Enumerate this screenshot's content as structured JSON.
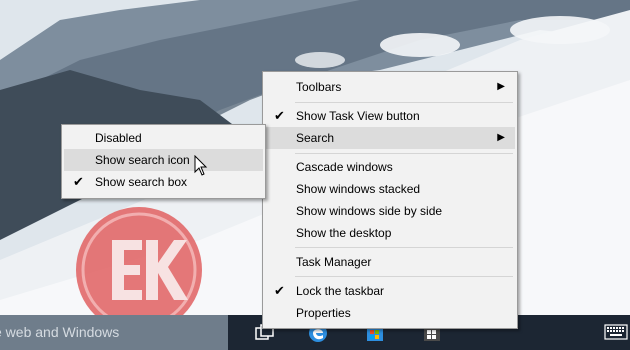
{
  "taskbar": {
    "search_text": "e web and Windows"
  },
  "main_menu": {
    "items": [
      {
        "label": "Toolbars",
        "checked": false,
        "submenu": true
      },
      {
        "label": "Show Task View button",
        "checked": true,
        "submenu": false
      },
      {
        "label": "Search",
        "checked": false,
        "submenu": true,
        "highlighted": true
      },
      {
        "label": "Cascade windows",
        "checked": false
      },
      {
        "label": "Show windows stacked",
        "checked": false
      },
      {
        "label": "Show windows side by side",
        "checked": false
      },
      {
        "label": "Show the desktop",
        "checked": false
      },
      {
        "label": "Task Manager",
        "checked": false
      },
      {
        "label": "Lock the taskbar",
        "checked": true
      },
      {
        "label": "Properties",
        "checked": false
      }
    ]
  },
  "sub_menu": {
    "items": [
      {
        "label": "Disabled",
        "checked": false
      },
      {
        "label": "Show search icon",
        "checked": false,
        "highlighted": true
      },
      {
        "label": "Show search box",
        "checked": true
      }
    ]
  },
  "glyphs": {
    "check": "✔",
    "arrow": "▶"
  },
  "icons": [
    "task-view-icon",
    "edge-icon",
    "store-icon",
    "windows-store-icon",
    "keyboard-icon"
  ]
}
